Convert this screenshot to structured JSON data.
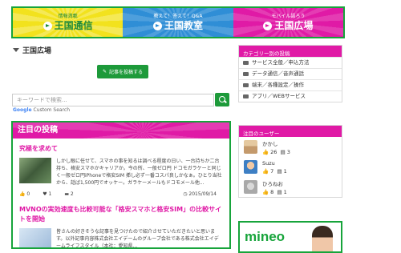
{
  "nav_banners": [
    {
      "sub": "情報満載",
      "main": "王国通信"
    },
    {
      "sub": "教えて！答えて！Q&A",
      "main": "王国教室"
    },
    {
      "sub": "モバイル語ろう",
      "main": "王国広場"
    }
  ],
  "page_title": "王国広場",
  "post_button": "記事を投稿する",
  "search": {
    "placeholder": "キーワードで検索...",
    "powered": "Custom Search"
  },
  "feed": {
    "heading": "注目の投稿",
    "posts": [
      {
        "title": "究極を求めて",
        "excerpt": "しかし眼に任せて、スマホの事を知るは調べる程度の日い、一台持ちか二台持ち、格安スマホかキャリアか。今の所、一般ゼロ円 ドコモガラケーと同じく一般ゼロ円iPhoneで格安SIM 挿し必ず一番コスパ良しかなぁ。ひとり当社から、話ば1,500円でオッケー。ガラケーメールもドコモメール他...",
        "likes": "0",
        "hearts": "1",
        "comments": "2",
        "date": "2015/09/14"
      },
      {
        "title": "MVNOの実効速度も比較可能な「格安スマホと格安SIM」の比較サイトを開始",
        "excerpt": "皆さんの好きそうな記事を見つけたので紹介させていただきたいと思います。以外記事内容株式会社エイデームのグループ会社である株式会社エイデームライフスタイル（本社：愛知県..."
      }
    ]
  },
  "sidebar": {
    "categories_heading": "カテゴリー別の投稿",
    "categories": [
      "サービス全般／申込方法",
      "データ通信／音声通話",
      "端末／各種設定／操作",
      "アプリ／WEBサービス"
    ],
    "users_heading": "注目のユーザー",
    "users": [
      {
        "name": "かかし",
        "likes": "26",
        "posts": "3"
      },
      {
        "name": "Suzu",
        "likes": "7",
        "posts": "1"
      },
      {
        "name": "ひろねお",
        "likes": "8",
        "posts": "1"
      }
    ],
    "ad_text": "mineo"
  },
  "colors": {
    "green": "#17a43b",
    "magenta": "#e01aa6",
    "yellow": "#f2e21d",
    "blue": "#2f8ed6"
  }
}
